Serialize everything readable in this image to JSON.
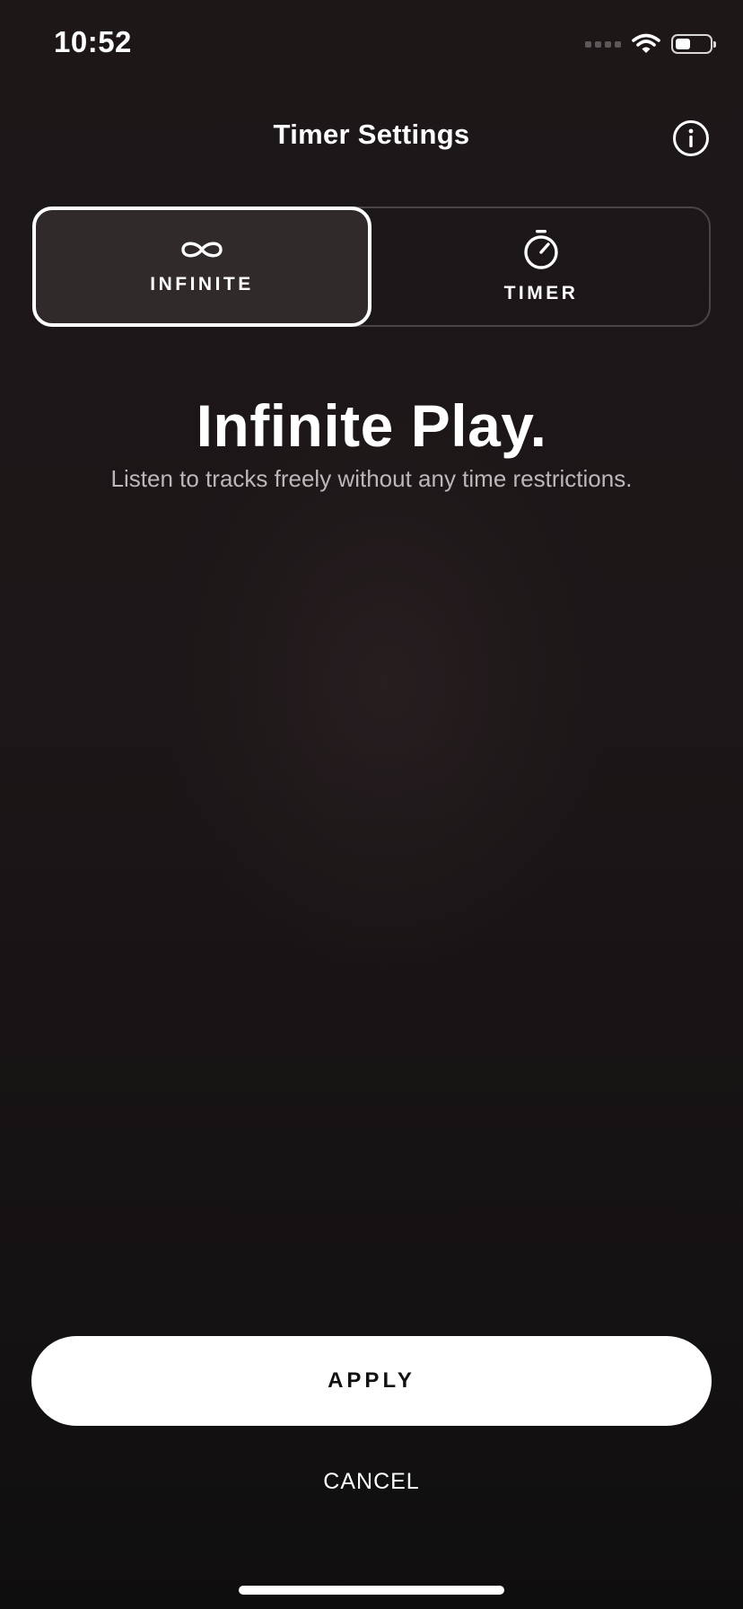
{
  "status_bar": {
    "time": "10:52",
    "signal_icon": "signal-dots-icon",
    "wifi_icon": "wifi-icon",
    "battery_icon": "battery-icon",
    "battery_level": 0.45
  },
  "header": {
    "title": "Timer Settings",
    "info_icon": "info-icon"
  },
  "mode_selector": {
    "selected": "infinite",
    "options": [
      {
        "id": "infinite",
        "label": "INFINITE",
        "icon": "infinity-icon"
      },
      {
        "id": "timer",
        "label": "TIMER",
        "icon": "stopwatch-icon"
      }
    ]
  },
  "content": {
    "headline": "Infinite Play.",
    "description": "Listen to tracks freely without any time restrictions."
  },
  "actions": {
    "apply_label": "APPLY",
    "cancel_label": "CANCEL"
  },
  "colors": {
    "background": "#1a1516",
    "accent": "#ffffff",
    "selected_segment": "#302a2b",
    "muted_text": "#bcb7b8"
  }
}
